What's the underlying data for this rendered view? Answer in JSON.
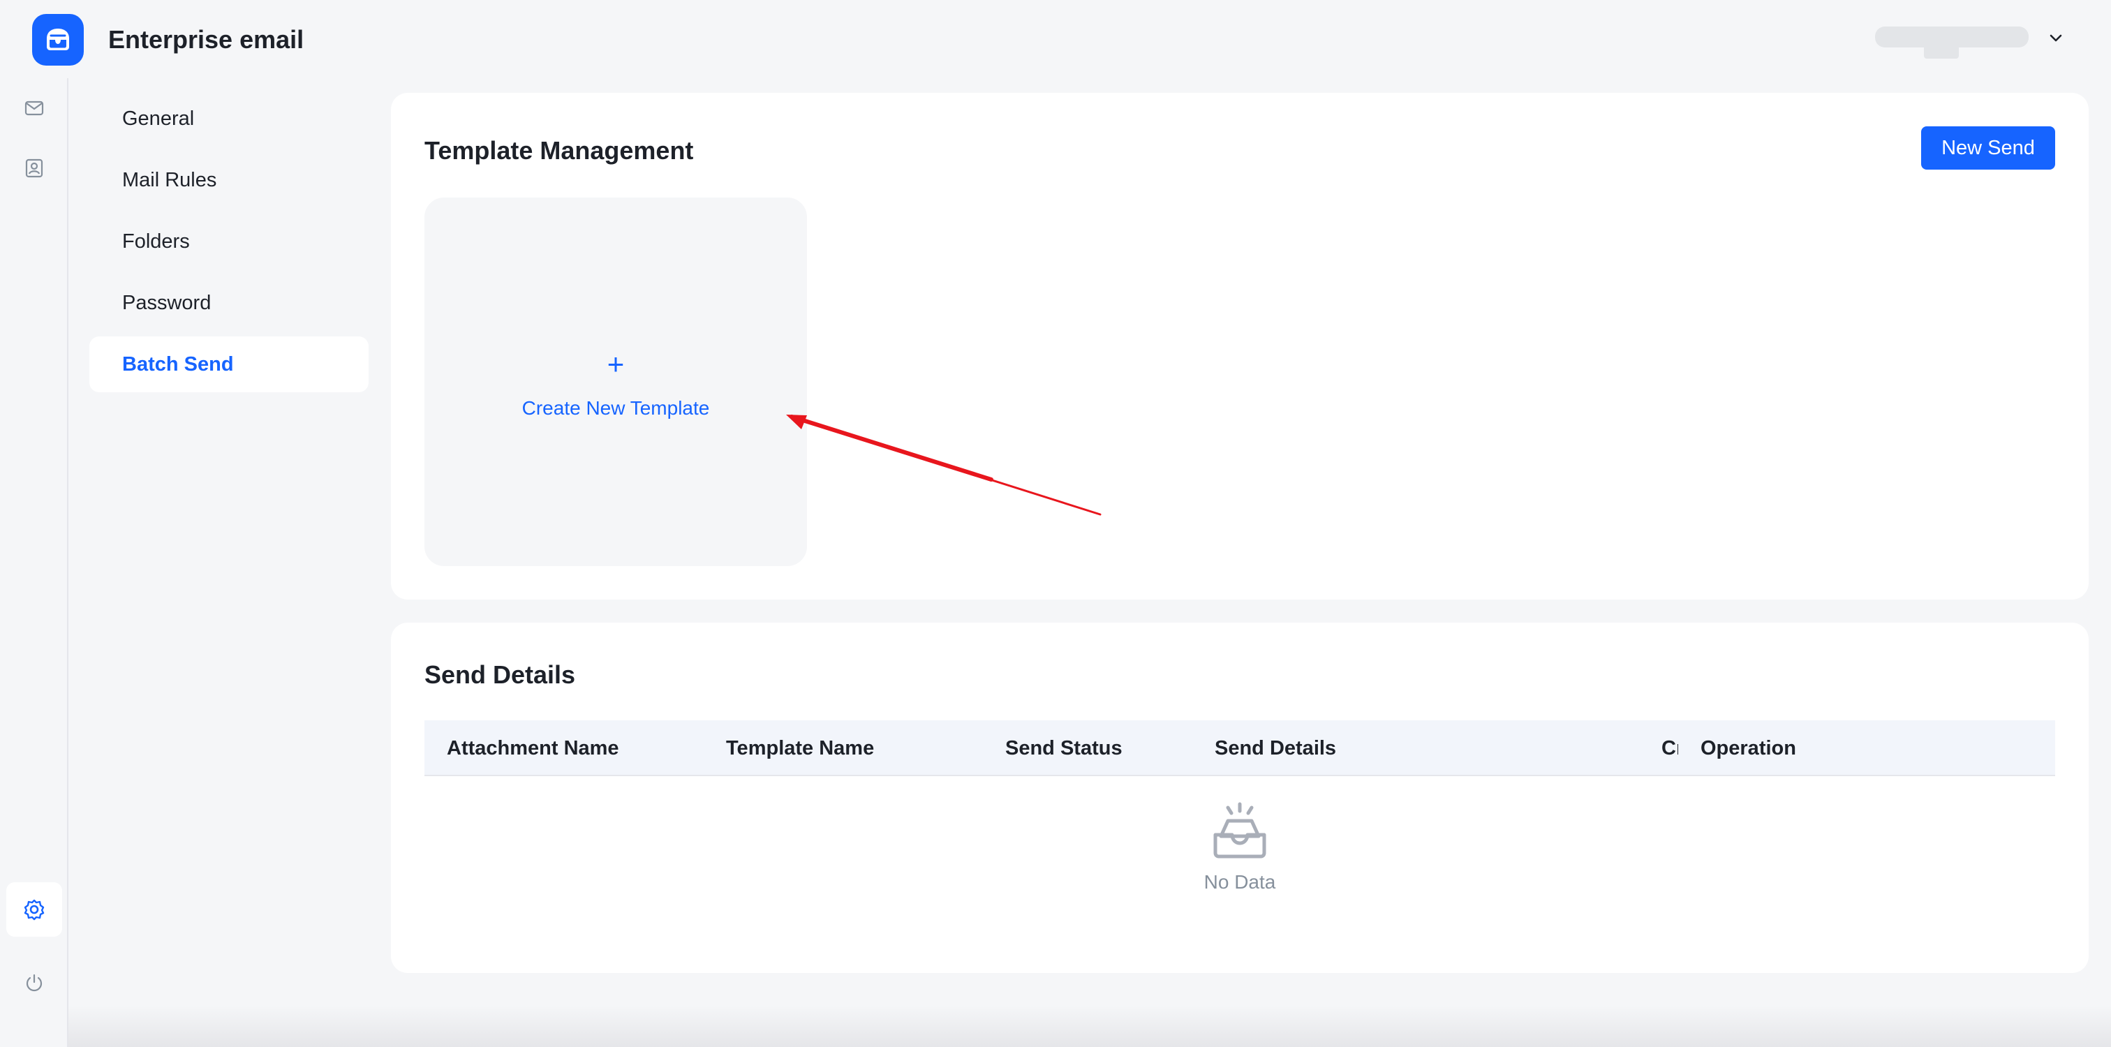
{
  "app": {
    "title": "Enterprise email",
    "accent_color": "#1664ff"
  },
  "rail": {
    "items": [
      {
        "icon": "mail-icon"
      },
      {
        "icon": "contacts-icon"
      },
      {
        "icon": "settings-icon",
        "active": true
      },
      {
        "icon": "power-icon"
      }
    ]
  },
  "menu": {
    "items": [
      {
        "label": "General"
      },
      {
        "label": "Mail Rules"
      },
      {
        "label": "Folders"
      },
      {
        "label": "Password"
      },
      {
        "label": "Batch Send",
        "active": true
      }
    ]
  },
  "template_management": {
    "title": "Template Management",
    "new_send_label": "New Send",
    "create_plus": "+",
    "create_label": "Create New Template"
  },
  "send_details": {
    "title": "Send Details",
    "columns": [
      "Attachment Name",
      "Template Name",
      "Send Status",
      "Send Details",
      "Cr",
      "Operation"
    ],
    "empty_text": "No Data"
  }
}
